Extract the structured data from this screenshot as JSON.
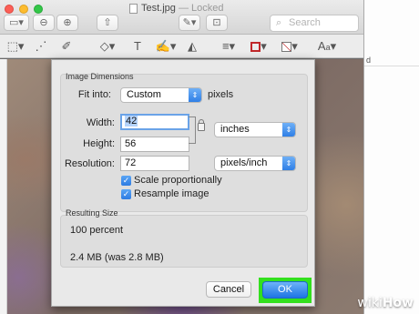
{
  "window": {
    "title": "Test.jpg",
    "status": "— Locked",
    "search_placeholder": "Search"
  },
  "toolbar_icons": [
    "sidebar-icon",
    "zoom-out-icon",
    "zoom-in-icon",
    "share-icon",
    "pen-icon",
    "toolbox-icon"
  ],
  "markup_icons": [
    "selection-icon",
    "magic-wand-icon",
    "sketch-icon",
    "shapes-icon",
    "text-icon",
    "sign-icon",
    "adjust-color-icon",
    "line-style-icon",
    "border-color-icon",
    "fill-color-icon",
    "font-icon"
  ],
  "right_doc": {
    "text": "d"
  },
  "dialog": {
    "image_dimensions_title": "Image Dimensions",
    "fit_into_label": "Fit into:",
    "fit_into_value": "Custom",
    "fit_into_unit": "pixels",
    "width_label": "Width:",
    "width_value": "42",
    "height_label": "Height:",
    "height_value": "56",
    "size_unit_value": "inches",
    "resolution_label": "Resolution:",
    "resolution_value": "72",
    "resolution_unit_value": "pixels/inch",
    "scale_label": "Scale proportionally",
    "scale_checked": true,
    "resample_label": "Resample image",
    "resample_checked": true,
    "resulting_size_title": "Resulting Size",
    "percent_text": "100 percent",
    "size_text": "2.4 MB (was 2.8 MB)",
    "cancel_label": "Cancel",
    "ok_label": "OK",
    "ok_highlight_color": "#33e01e"
  },
  "watermark": {
    "wiki": "wiki",
    "how": "How"
  }
}
